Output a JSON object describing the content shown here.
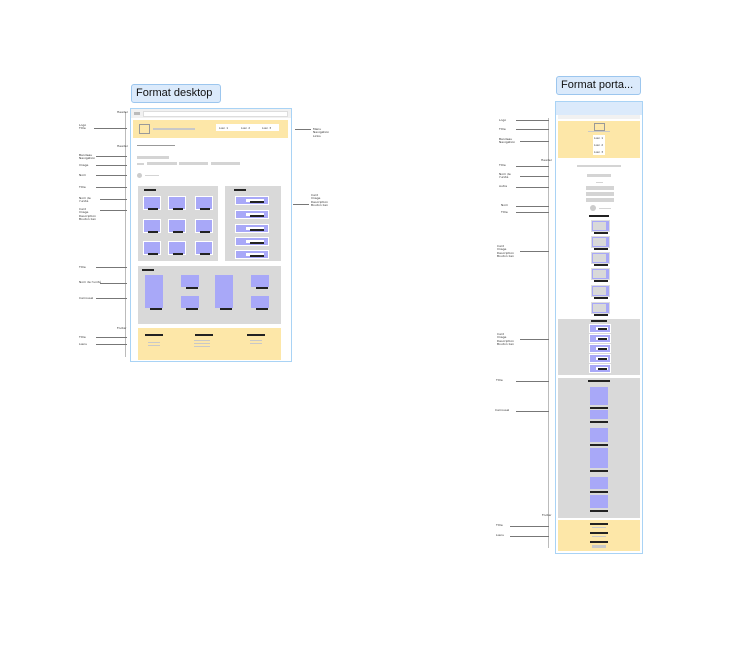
{
  "frames": {
    "desktop": {
      "label": "Format desktop",
      "left_annotations": [
        "Logo\nTitre",
        "Header",
        "Bandeau\nNavigation",
        "Image",
        "Nom",
        "Titre",
        "Nom de\nl'unité",
        "Card\nImage\nDescription\nBouton lien",
        "Titre",
        "Nom de l'unité",
        "Carrousel",
        "Footer",
        "Titre",
        "Liens"
      ],
      "right_annotation_top": "Menu\nNavigation\nLinks",
      "right_annotation_mid": "Card\nImage\nDescription\nBouton lien",
      "nav_labels": [
        "Lien 1",
        "Lien 2",
        "Lien 3"
      ]
    },
    "portable": {
      "label": "Format porta...",
      "left_annotations": [
        "Logo",
        "Titre",
        "Bandeau\nNavigation",
        "Header",
        "Titre",
        "Nom de\nl'unité",
        "Autre",
        "Nom",
        "Titre",
        "Card\nImage\nDescription\nBouton lien",
        "Card\nImage\nDescription\nBouton lien",
        "Titre",
        "Carrousel",
        "Footer",
        "Titre",
        "Liens"
      ],
      "nav_labels": [
        "Lien 1",
        "Lien 2",
        "Lien 3"
      ]
    }
  }
}
